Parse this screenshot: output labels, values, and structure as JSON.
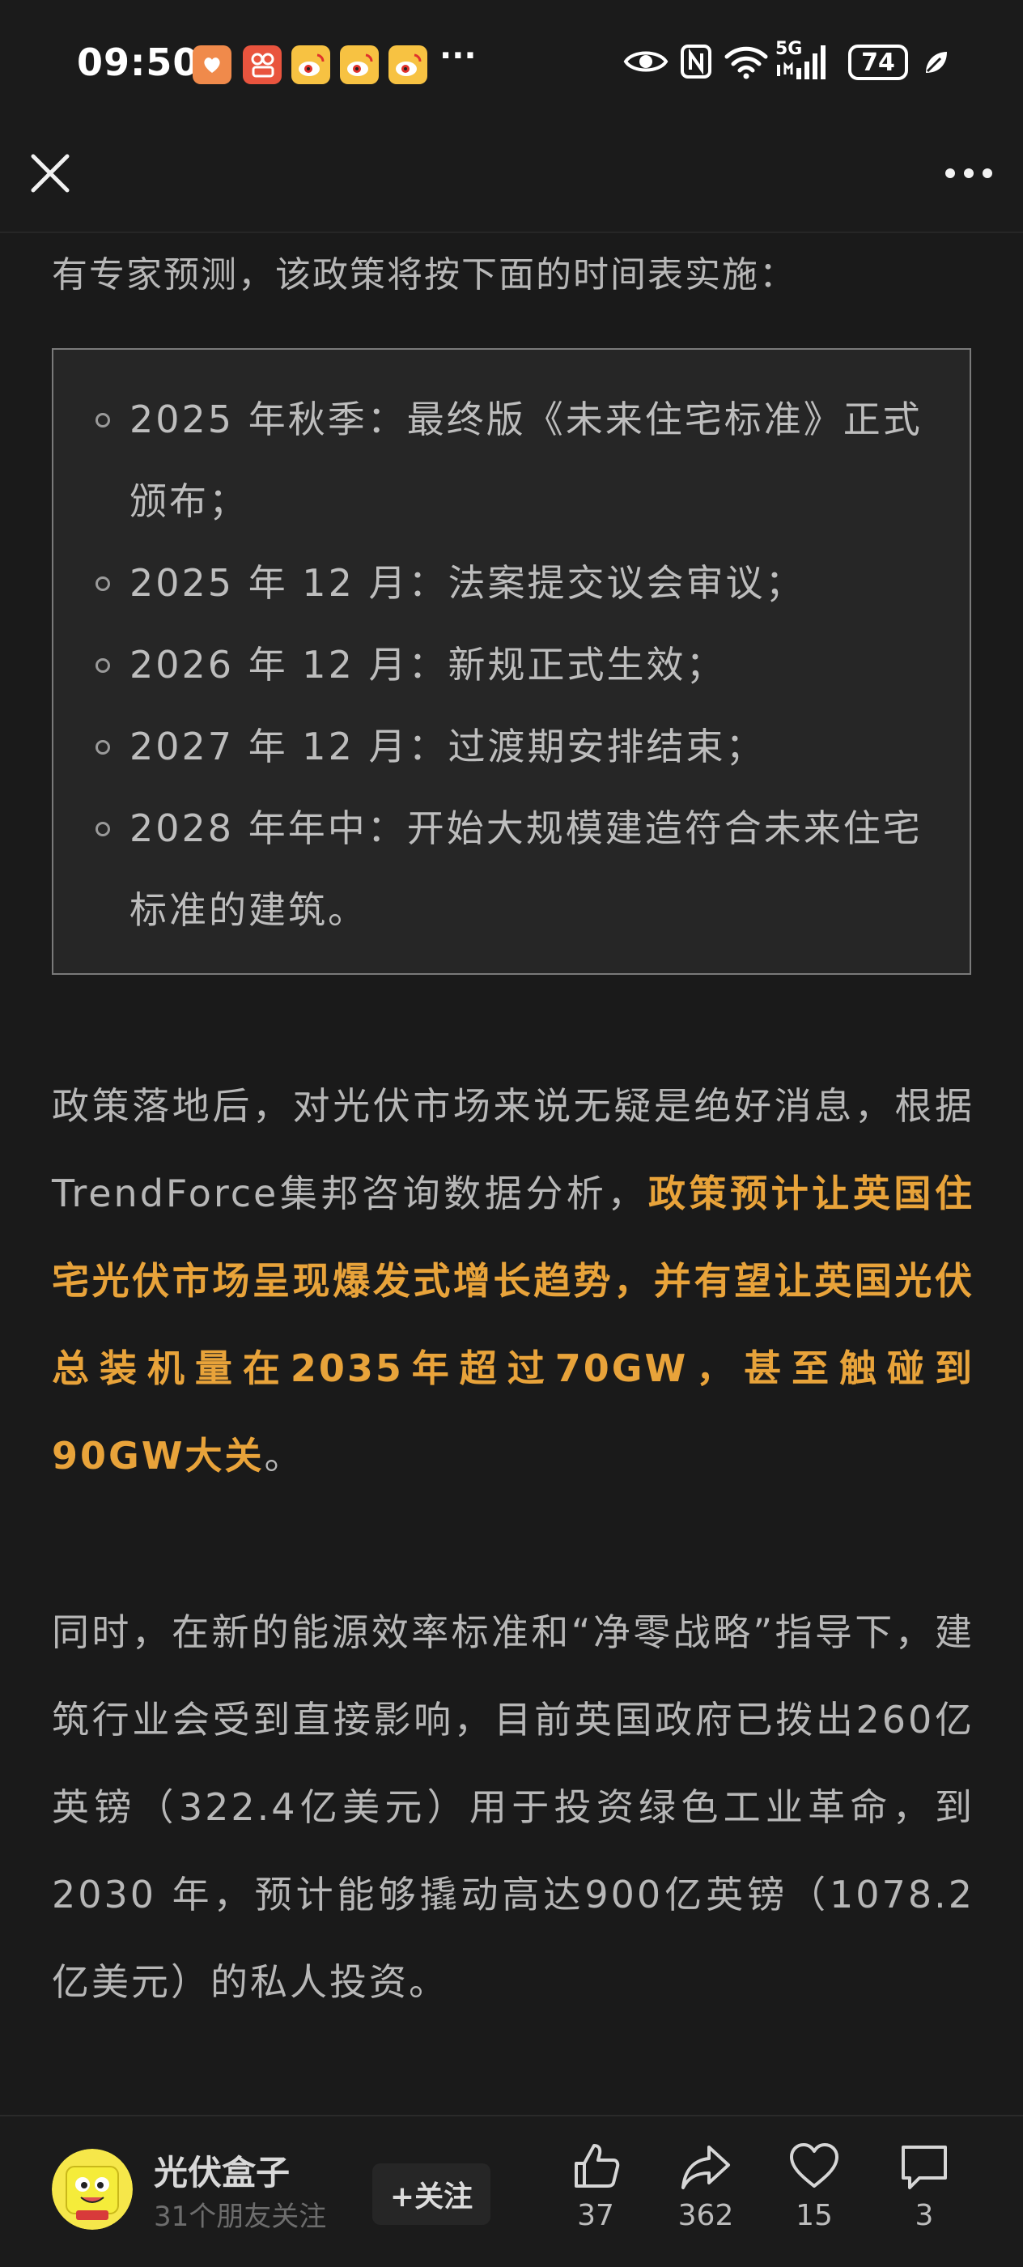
{
  "status_bar": {
    "time": "09:50",
    "notification_more": "···",
    "battery": "74",
    "network": "5G",
    "app_icons": [
      "taobao-icon",
      "app-icon",
      "weibo-icon",
      "weibo-icon",
      "weibo-icon"
    ],
    "system_icons": [
      "eye-icon",
      "nfc-icon",
      "wifi-icon",
      "signal-icon",
      "battery-icon",
      "leaf-icon"
    ]
  },
  "top_bar": {
    "close_icon": "close-icon",
    "more_icon": "more-dots-icon"
  },
  "article": {
    "intro": "有专家预测，该政策将按下面的时间表实施：",
    "timeline": [
      "2025 年秋季：最终版《未来住宅标准》正式颁布；",
      "2025 年 12 月：法案提交议会审议；",
      "2026 年 12 月：新规正式生效；",
      "2027 年 12 月：过渡期安排结束；",
      "2028 年年中：开始大规模建造符合未来住宅标准的建筑。"
    ],
    "paragraph1_plain": "政策落地后，对光伏市场来说无疑是绝好消息，根据TrendForce集邦咨询数据分析，",
    "paragraph1_highlight": "政策预计让英国住宅光伏市场呈现爆发式增长趋势，并有望让英国光伏总装机量在2035年超过70GW，甚至触碰到90GW大关",
    "paragraph1_end": "。",
    "paragraph2": "同时，在新的能源效率标准和“净零战略”指导下，建筑行业会受到直接影响，目前英国政府已拨出260亿英镑（322.4亿美元）用于投资绿色工业革命，到 2030 年，预计能够撬动高达900亿英镑（1078.2 亿美元）的私人投资。"
  },
  "bottom_bar": {
    "author_name": "光伏盒子",
    "author_sub": "31个朋友关注",
    "follow_label": "+关注",
    "likes": "37",
    "shares": "362",
    "favorites": "15",
    "comments": "3"
  },
  "colors": {
    "background": "#1a1a1a",
    "text": "#b7b7b7",
    "highlight": "#e8a33a",
    "box_bg": "#262626",
    "box_border": "#7a7a7a"
  }
}
